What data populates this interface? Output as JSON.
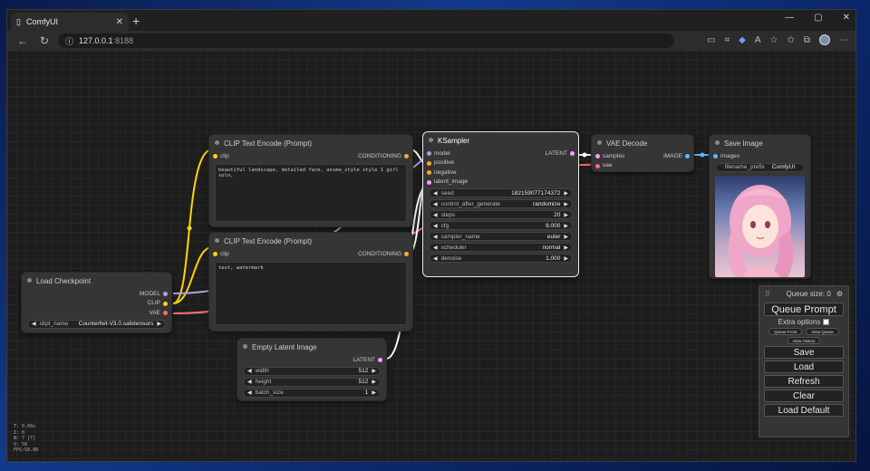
{
  "browser": {
    "tab_title": "ComfyUI",
    "url_host": "127.0.0.1",
    "url_port": ":8188"
  },
  "nodes": {
    "clip1": {
      "title": "CLIP Text Encode (Prompt)",
      "input": "clip",
      "output": "CONDITIONING",
      "text": "beautiful landscape, detailed face, anime_style style 1 girl solo,"
    },
    "clip2": {
      "title": "CLIP Text Encode (Prompt)",
      "input": "clip",
      "output": "CONDITIONING",
      "text": "text, watermark"
    },
    "ksampler": {
      "title": "KSampler",
      "inputs": [
        "model",
        "positive",
        "negative",
        "latent_image"
      ],
      "output": "LATENT",
      "widgets": [
        {
          "label": "seed",
          "value": "182159077174372"
        },
        {
          "label": "control_after_generate",
          "value": "randomize"
        },
        {
          "label": "steps",
          "value": "20"
        },
        {
          "label": "cfg",
          "value": "8.000"
        },
        {
          "label": "sampler_name",
          "value": "euler"
        },
        {
          "label": "scheduler",
          "value": "normal"
        },
        {
          "label": "denoise",
          "value": "1.000"
        }
      ]
    },
    "vae_decode": {
      "title": "VAE Decode",
      "inputs": [
        "samples",
        "vae"
      ],
      "output": "IMAGE"
    },
    "save_image": {
      "title": "Save Image",
      "input": "images",
      "widget_label": "filename_prefix",
      "widget_value": "ComfyUI"
    },
    "checkpoint": {
      "title": "Load Checkpoint",
      "outputs": [
        "MODEL",
        "CLIP",
        "VAE"
      ],
      "widget_label": "ckpt_name",
      "widget_value": "Counterfeit-V3.0.safetensors"
    },
    "latent": {
      "title": "Empty Latent Image",
      "output": "LATENT",
      "widgets": [
        {
          "label": "width",
          "value": "512"
        },
        {
          "label": "height",
          "value": "512"
        },
        {
          "label": "batch_size",
          "value": "1"
        }
      ]
    }
  },
  "queue_panel": {
    "queue_size": "Queue size: 0",
    "queue_prompt": "Queue Prompt",
    "extra_options": "Extra options",
    "queue_front": "Queue Front",
    "view_queue": "View Queue",
    "view_history": "View History",
    "save": "Save",
    "load": "Load",
    "refresh": "Refresh",
    "clear": "Clear",
    "load_default": "Load Default"
  },
  "stats": [
    "T: 0.00s",
    "I: 0",
    "N: 7 [7]",
    "V: 58",
    "FPS:58.88"
  ],
  "colors": {
    "clip_link": "#ffd500",
    "model_link": "#b39ddb",
    "vae_link": "#ff6e6e",
    "latent_link": "#ff9cf9",
    "image_link": "#64b5f6",
    "conditioning_link": "#ffa931"
  }
}
